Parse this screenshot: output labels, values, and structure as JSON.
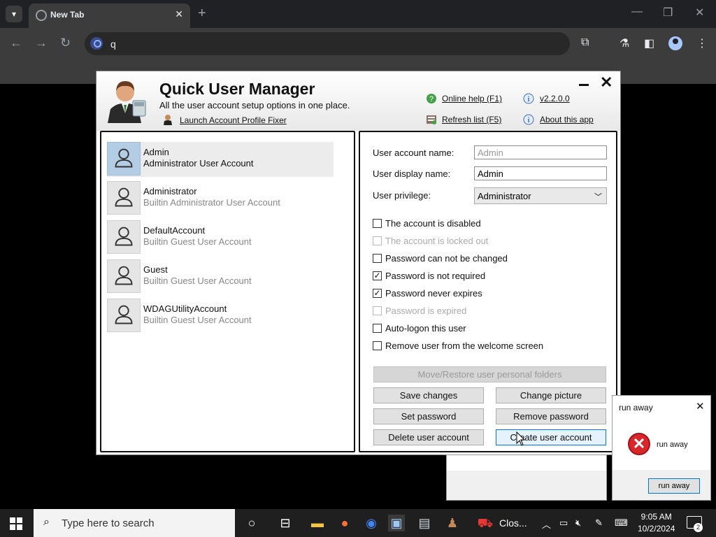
{
  "browser": {
    "tab_title": "New Tab",
    "address_value": "q"
  },
  "app": {
    "title": "Quick User Manager",
    "subtitle": "All the user account setup options in one place.",
    "launch_link": "Launch Account Profile Fixer",
    "online_help": "Online help (F1)",
    "refresh_list": "Refresh list (F5)",
    "version": "v2.2.0.0",
    "about": "About this app"
  },
  "users": [
    {
      "name": "Admin",
      "desc": "Administrator User Account",
      "selected": true
    },
    {
      "name": "Administrator",
      "desc": "Builtin Administrator User Account"
    },
    {
      "name": "DefaultAccount",
      "desc": "Builtin Guest User Account"
    },
    {
      "name": "Guest",
      "desc": "Builtin Guest User Account"
    },
    {
      "name": "WDAGUtilityAccount",
      "desc": "Builtin Guest User Account"
    }
  ],
  "form": {
    "account_name_label": "User account name:",
    "account_name_placeholder": "Admin",
    "display_name_label": "User display name:",
    "display_name_value": "Admin",
    "privilege_label": "User privilege:",
    "privilege_value": "Administrator",
    "checkboxes": [
      {
        "label": "The account is disabled",
        "checked": false,
        "enabled": true
      },
      {
        "label": "The account is locked out",
        "checked": false,
        "enabled": false
      },
      {
        "label": "Password can not be changed",
        "checked": false,
        "enabled": true
      },
      {
        "label": "Password is not required",
        "checked": true,
        "enabled": true
      },
      {
        "label": "Password never expires",
        "checked": true,
        "enabled": true
      },
      {
        "label": "Password is expired",
        "checked": false,
        "enabled": false
      },
      {
        "label": "Auto-logon this user",
        "checked": false,
        "enabled": true
      },
      {
        "label": "Remove user from the welcome screen",
        "checked": false,
        "enabled": true
      }
    ],
    "move_restore": "Move/Restore user personal folders",
    "save_changes": "Save changes",
    "change_picture": "Change picture",
    "set_password": "Set password",
    "remove_password": "Remove password",
    "delete_account": "Delete user account",
    "create_account": "Create user account"
  },
  "dialog": {
    "title": "run away",
    "message": "run away",
    "button": "run away"
  },
  "taskbar": {
    "search_placeholder": "Type here to search",
    "app_label": "Clos...",
    "time": "9:05 AM",
    "date": "10/2/2024",
    "notifications": "2"
  }
}
